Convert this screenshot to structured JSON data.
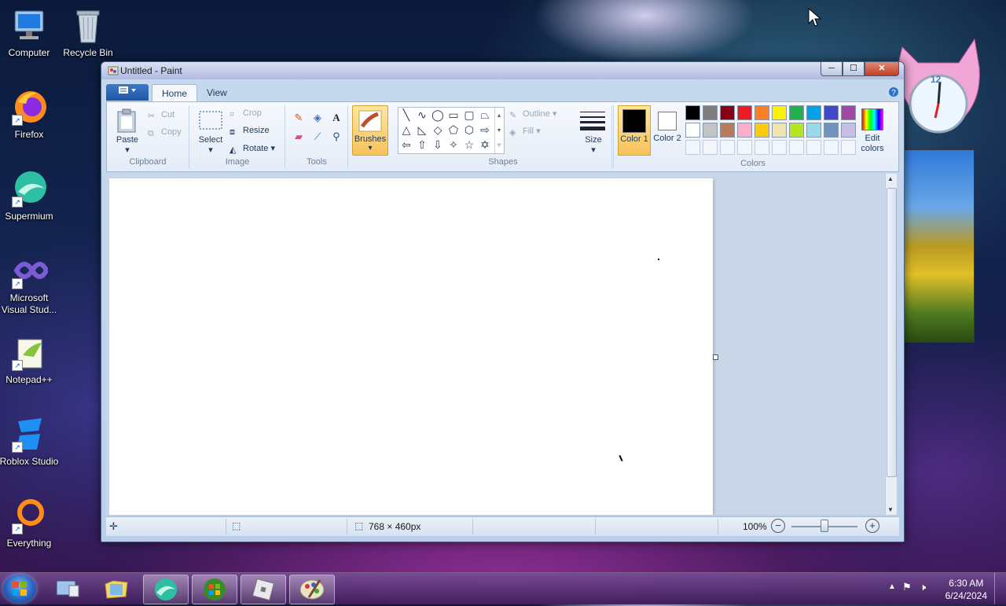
{
  "desktop": {
    "icons": [
      {
        "label": "Computer",
        "icon": "computer-icon"
      },
      {
        "label": "Recycle Bin",
        "icon": "recycle-bin-icon"
      },
      {
        "label": "Firefox",
        "icon": "firefox-icon"
      },
      {
        "label": "Supermium",
        "icon": "supermium-icon"
      },
      {
        "label": "Microsoft Visual Stud...",
        "icon": "visual-studio-icon"
      },
      {
        "label": "Notepad++",
        "icon": "notepadpp-icon"
      },
      {
        "label": "Roblox Studio",
        "icon": "roblox-studio-icon"
      },
      {
        "label": "Everything",
        "icon": "everything-icon"
      }
    ]
  },
  "gadgets": {
    "clock_number": "12"
  },
  "window": {
    "title": "Untitled - Paint",
    "controls": {
      "minimize": "─",
      "maximize": "☐",
      "close": "✕"
    }
  },
  "ribbon": {
    "tabs": [
      "Home",
      "View"
    ],
    "clipboard": {
      "paste": "Paste",
      "cut": "Cut",
      "copy": "Copy",
      "group": "Clipboard"
    },
    "image": {
      "select": "Select",
      "crop": "Crop",
      "resize": "Resize",
      "rotate": "Rotate",
      "group": "Image"
    },
    "tools": {
      "group": "Tools"
    },
    "brushes": {
      "label": "Brushes"
    },
    "shapes": {
      "outline": "Outline",
      "fill": "Fill",
      "size": "Size",
      "group": "Shapes"
    },
    "colors": {
      "color1_label": "Color 1",
      "color2_label": "Color 2",
      "edit_colors": "Edit colors",
      "group": "Colors",
      "palette_row1": [
        "#000000",
        "#7f7f7f",
        "#880015",
        "#ed1c24",
        "#ff7f27",
        "#fff200",
        "#22b14c",
        "#00a2e8",
        "#3f48cc",
        "#a349a4"
      ],
      "palette_row2": [
        "#ffffff",
        "#c3c3c3",
        "#b97a57",
        "#ffaec9",
        "#ffc90e",
        "#efe4b0",
        "#b5e61d",
        "#99d9ea",
        "#7092be",
        "#c8bfe7"
      ],
      "color1": "#000000",
      "color2": "#ffffff"
    }
  },
  "status": {
    "dimensions": "768 × 460px",
    "zoom": "100%"
  },
  "taskbar": {
    "time": "6:30 AM",
    "date": "6/24/2024"
  }
}
